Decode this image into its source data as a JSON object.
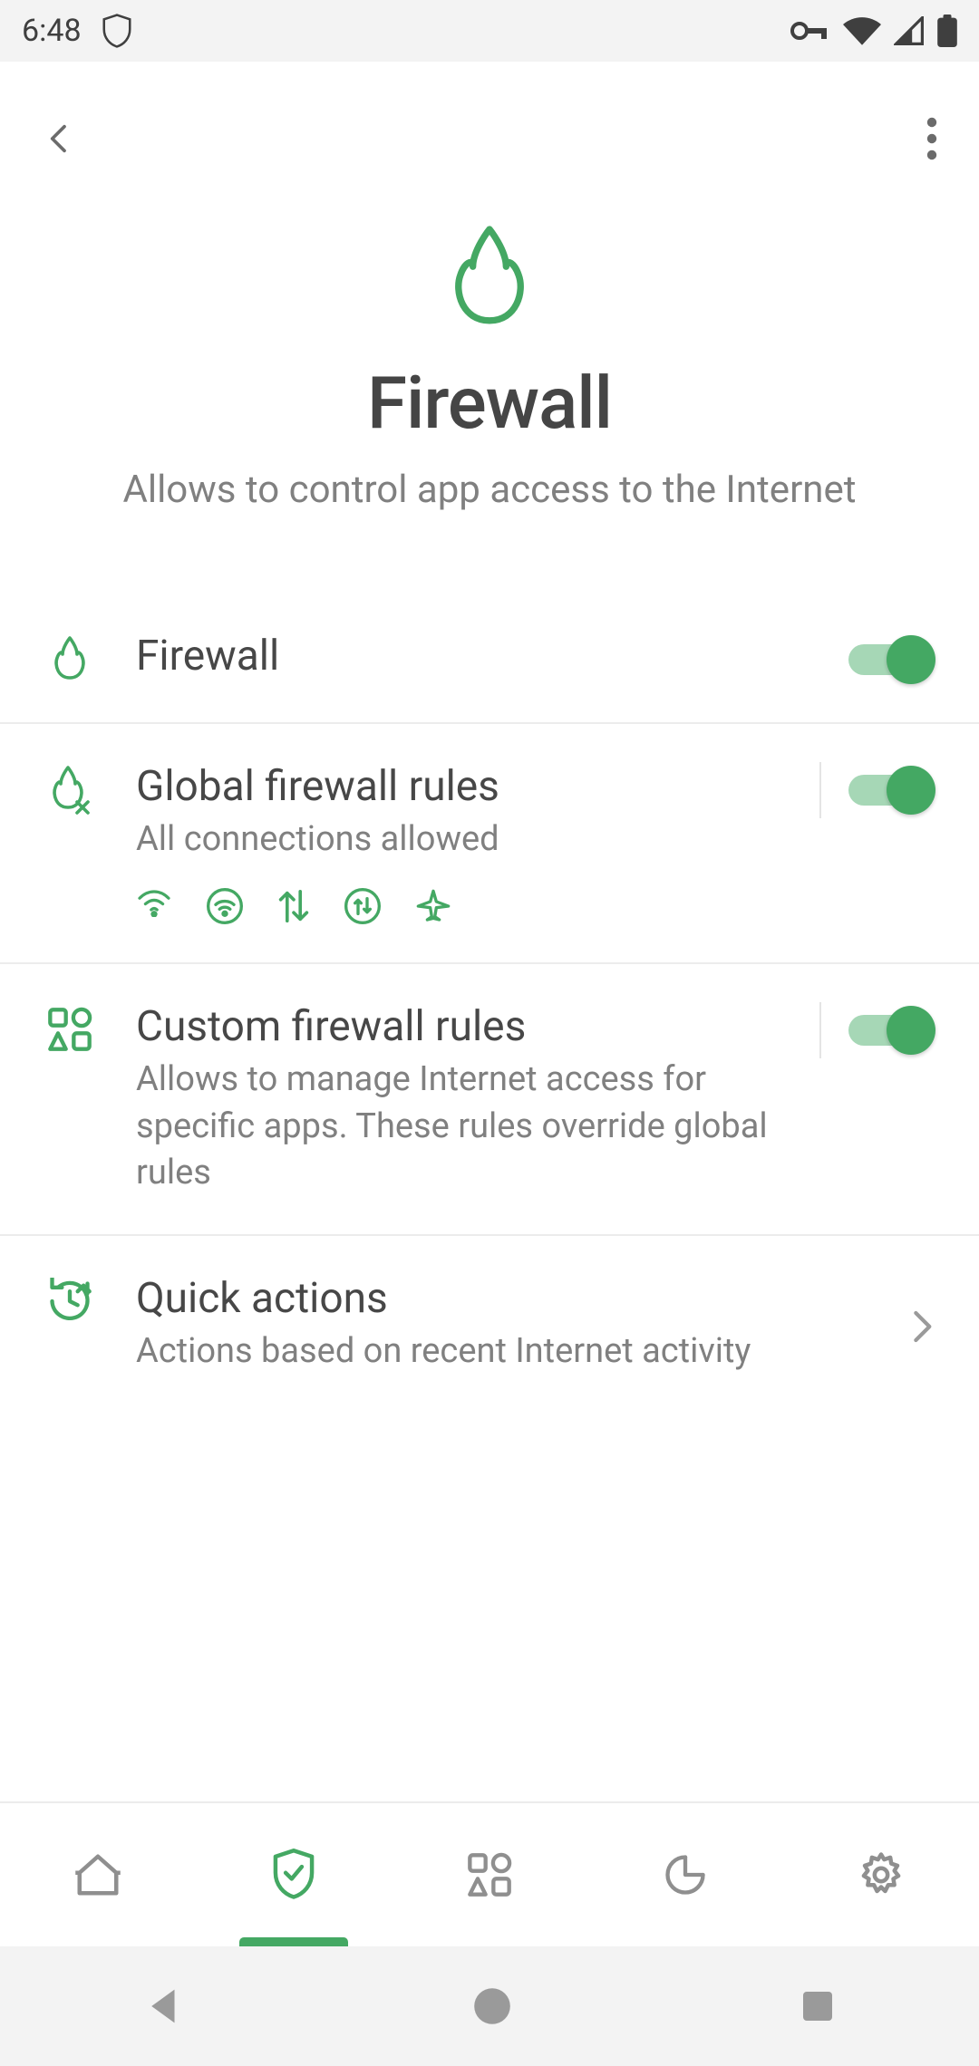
{
  "status": {
    "time": "6:48"
  },
  "hero": {
    "title": "Firewall",
    "subtitle": "Allows to control app access to the Internet"
  },
  "rows": {
    "firewall": {
      "title": "Firewall"
    },
    "global": {
      "title": "Global firewall rules",
      "sub": "All connections allowed"
    },
    "custom": {
      "title": "Custom firewall rules",
      "sub": "Allows to manage Internet access for specific apps. These rules override global rules"
    },
    "quick": {
      "title": "Quick actions",
      "sub": "Actions based on recent Internet activity"
    }
  },
  "colors": {
    "accent": "#44a863",
    "muted": "#808080"
  }
}
